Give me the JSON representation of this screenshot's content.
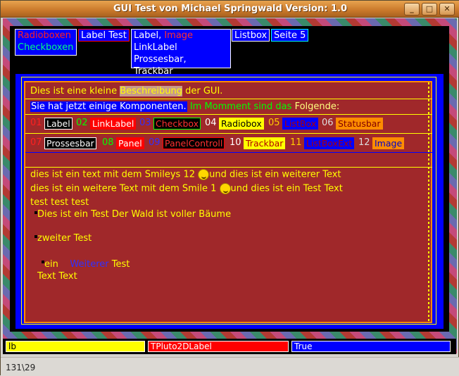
{
  "window": {
    "title": "GUI Test von Michael Springwald Version: 1.0"
  },
  "titlebar_buttons": {
    "minimize": "_",
    "maximize": "□",
    "close": "✕"
  },
  "tabs": {
    "tab1_line1": "Radioboxen",
    "tab1_line2": "Checkboxen",
    "tab2": "Label Test",
    "tab3_label": "Label,",
    "tab3_image": "Image",
    "tab3_line2": "LinkLabel",
    "tab3_line3": "Prossesbar, Trackbar",
    "tab4": "Listbox",
    "tab5": "Seite 5"
  },
  "content": {
    "desc_prefix": "Dies ist eine kleine",
    "desc_highlight": "Beschreibung",
    "desc_suffix": "der GUI.",
    "line2_a": "Sie hat jetzt einige Komponenten.",
    "line2_b": "Im Momment sind das",
    "line2_c": "Folgende:",
    "row1": [
      {
        "num": "01",
        "label": "Label"
      },
      {
        "num": "02",
        "label": "LinkLabel"
      },
      {
        "num": "03",
        "label": "Checkbox"
      },
      {
        "num": "04",
        "label": "Radiobox"
      },
      {
        "num": "05",
        "label": "ListBox"
      },
      {
        "num": "06",
        "label": "Statusbar"
      }
    ],
    "row2": [
      {
        "num": "07",
        "label": "Prossesbar"
      },
      {
        "num": "08",
        "label": "Panel"
      },
      {
        "num": "09",
        "label": "PanelControll"
      },
      {
        "num": "10",
        "label": "Trackbar"
      },
      {
        "num": "11",
        "label": "ListBoxExt"
      },
      {
        "num": "12",
        "label": "Image"
      }
    ],
    "smiley1_a": "dies ist ein text mit dem Smileys 12",
    "smiley1_b": "und dies ist ein weiterer Text",
    "smiley2_a": "dies ist ein weitere Text mit dem Smile 1",
    "smiley2_b": "und dies ist ein Test Text",
    "test_line": "test test test",
    "bullet1": "Dies ist ein Test Der Wald ist voller Bäume",
    "bullet2": "zweiter Test",
    "bullet3_a": "ein",
    "bullet3_b": "Weiterer",
    "bullet3_c": "Test",
    "text_text": "Text Text"
  },
  "status_panels": {
    "p1": "lb",
    "p2": "TPluto2DLabel",
    "p3": "True"
  },
  "statusbar": {
    "text": "131\\29"
  },
  "colors": {
    "panel_red": "#a0282a",
    "blue": "#0000ff",
    "yellow": "#ffff00",
    "green": "#00cc00"
  }
}
